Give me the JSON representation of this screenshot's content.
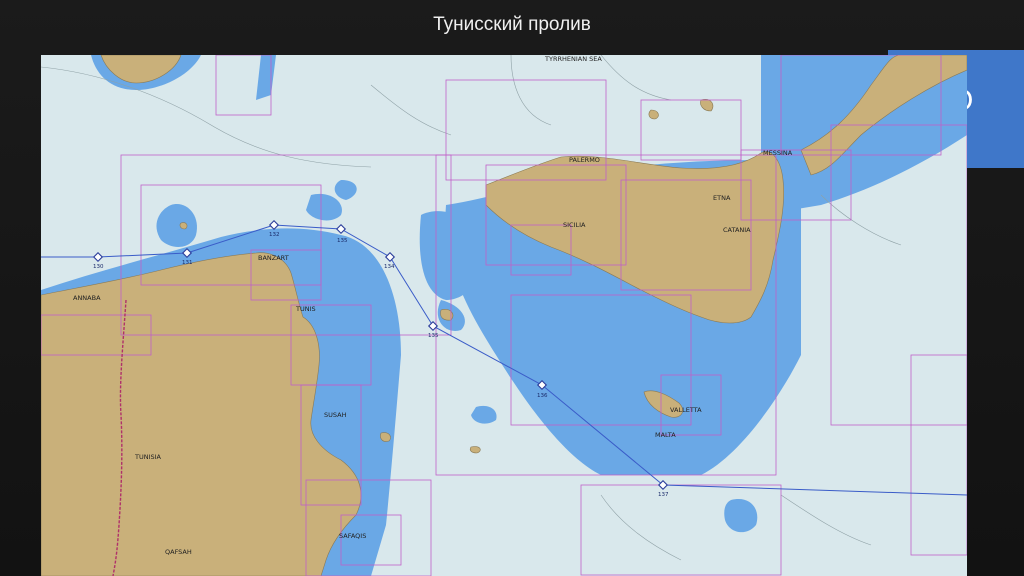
{
  "slide": {
    "title": "Тунисский пролив",
    "accent_letter": "O"
  },
  "colors": {
    "land": "#c9b07a",
    "deep_water": "#dbe9ed",
    "shallow": "#6aa8e6",
    "chart_bounds": "#c060c8",
    "route": "#3a5cc8",
    "border": "#b0306a"
  },
  "map": {
    "place_labels": {
      "tyrrhenian_sea": "TYRRHENIAN SEA",
      "palermo": "PALERMO",
      "messina": "MESSINA",
      "etna": "ETNA",
      "sicilia": "SICILIA",
      "catania": "CATANIA",
      "banzart": "BANZART",
      "annaba": "ANNABA",
      "tunis": "TUNIS",
      "valletta": "VALLETTA",
      "malta": "MALTA",
      "susah": "SUSAH",
      "tunisia": "TUNISIA",
      "safaqis": "SAFAQIS",
      "qafsah": "QAFSAH"
    },
    "waypoints": [
      {
        "id": "130"
      },
      {
        "id": "131"
      },
      {
        "id": "132"
      },
      {
        "id": "135"
      },
      {
        "id": "134"
      },
      {
        "id": "135"
      },
      {
        "id": "136"
      },
      {
        "id": "137"
      }
    ]
  }
}
